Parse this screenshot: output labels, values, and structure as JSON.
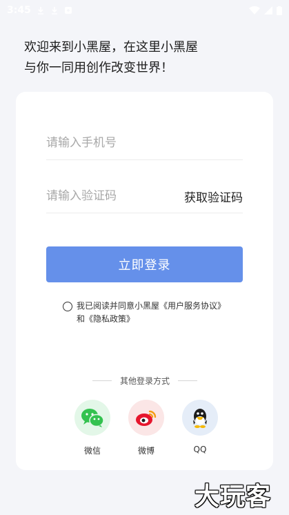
{
  "status_bar": {
    "time": "3:45"
  },
  "welcome": {
    "line1": "欢迎来到小黑屋，在这里小黑屋",
    "line2": "与你一同用创作改变世界！"
  },
  "form": {
    "phone_placeholder": "请输入手机号",
    "code_placeholder": "请输入验证码",
    "get_code_label": "获取验证码",
    "login_label": "立即登录"
  },
  "agreement": {
    "prefix": "我已阅读并同意小黑屋",
    "user_agreement": "《用户服务协议》",
    "and": "和",
    "privacy_policy": "《隐私政策》"
  },
  "other_login": {
    "title": "其他登录方式",
    "options": [
      {
        "label": "微信",
        "icon": "wechat-icon"
      },
      {
        "label": "微博",
        "icon": "weibo-icon"
      },
      {
        "label": "QQ",
        "icon": "qq-icon"
      }
    ]
  },
  "watermark": "大玩客",
  "colors": {
    "accent": "#6590ea",
    "wechat": "#33c24f",
    "weibo": "#e6162d",
    "qq": "#1d1d1d"
  }
}
